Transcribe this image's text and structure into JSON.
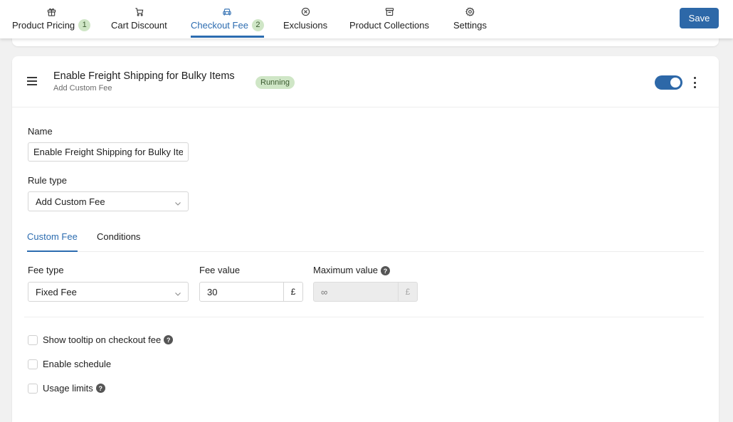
{
  "nav": {
    "tabs": [
      {
        "label": "Product Pricing",
        "count": "1",
        "icon": "gift-icon"
      },
      {
        "label": "Cart Discount",
        "count": "",
        "icon": "cart-icon"
      },
      {
        "label": "Checkout Fee",
        "count": "2",
        "icon": "truck-icon",
        "active": true
      },
      {
        "label": "Exclusions",
        "count": "",
        "icon": "circle-x-icon"
      },
      {
        "label": "Product Collections",
        "count": "",
        "icon": "collection-icon"
      },
      {
        "label": "Settings",
        "count": "",
        "icon": "gear-icon"
      }
    ],
    "save_label": "Save"
  },
  "rule": {
    "title": "Enable Freight Shipping for Bulky Items",
    "subtitle": "Add Custom Fee",
    "status": "Running",
    "enabled": true
  },
  "form": {
    "name_label": "Name",
    "name_value": "Enable Freight Shipping for Bulky Items",
    "rule_type_label": "Rule type",
    "rule_type_value": "Add Custom Fee",
    "subtabs": [
      {
        "label": "Custom Fee",
        "active": true
      },
      {
        "label": "Conditions",
        "active": false
      }
    ],
    "fee_type_label": "Fee type",
    "fee_type_value": "Fixed Fee",
    "fee_value_label": "Fee value",
    "fee_value": "30",
    "fee_currency": "£",
    "max_value_label": "Maximum value",
    "max_value_placeholder": "∞",
    "max_currency": "£",
    "checkboxes": [
      {
        "label": "Show tooltip on checkout fee",
        "checked": false,
        "help": true
      },
      {
        "label": "Enable schedule",
        "checked": false,
        "help": false
      },
      {
        "label": "Usage limits",
        "checked": false,
        "help": true
      }
    ],
    "help_glyph": "?"
  },
  "colors": {
    "accent": "#2c6cb0",
    "save_button": "#2d68a8",
    "badge_bg": "#cfe6c6",
    "badge_text": "#3a5a2f",
    "page_bg": "#f1f1f1"
  }
}
